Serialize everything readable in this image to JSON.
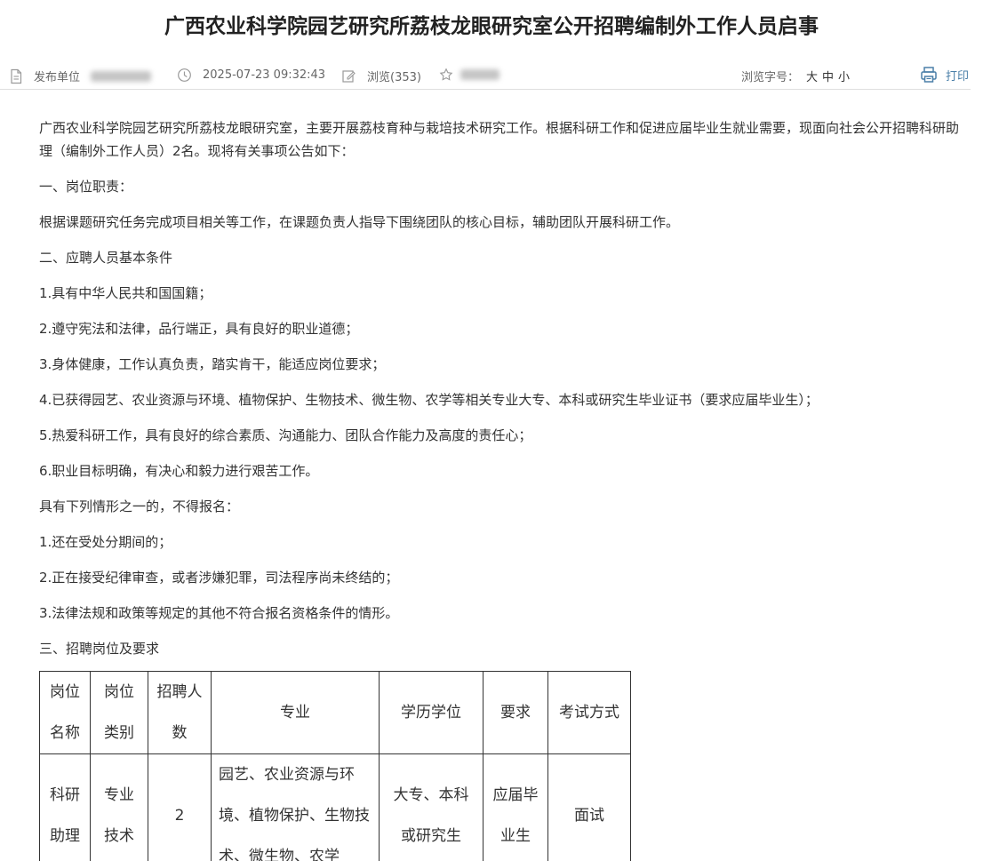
{
  "title": "广西农业科学院园艺研究所荔枝龙眼研究室公开招聘编制外工作人员启事",
  "meta": {
    "publisher_label": "发布单位",
    "datetime": "2025-07-23 09:32:43",
    "views": "浏览(353)",
    "font_size_label": "浏览字号：",
    "font_large": "大",
    "font_medium": "中",
    "font_small": "小",
    "print_label": "打印"
  },
  "body": {
    "intro": "广西农业科学院园艺研究所荔枝龙眼研究室，主要开展荔枝育种与栽培技术研究工作。根据科研工作和促进应届毕业生就业需要，现面向社会公开招聘科研助理（编制外工作人员）2名。现将有关事项公告如下：",
    "section1_title": "一、岗位职责：",
    "section1_text": "根据课题研究任务完成项目相关等工作，在课题负责人指导下围绕团队的核心目标，辅助团队开展科研工作。",
    "section2_title": "二、应聘人员基本条件",
    "conditions": [
      "1.具有中华人民共和国国籍；",
      "2.遵守宪法和法律，品行端正，具有良好的职业道德；",
      "3.身体健康，工作认真负责，踏实肯干，能适应岗位要求；",
      "4.已获得园艺、农业资源与环境、植物保护、生物技术、微生物、农学等相关专业大专、本科或研究生毕业证书（要求应届毕业生）；",
      "5.热爱科研工作，具有良好的综合素质、沟通能力、团队合作能力及高度的责任心；",
      "6.职业目标明确，有决心和毅力进行艰苦工作。"
    ],
    "exclusion_title": "具有下列情形之一的，不得报名：",
    "exclusions": [
      "1.还在受处分期间的；",
      "2.正在接受纪律审查，或者涉嫌犯罪，司法程序尚未终结的；",
      "3.法律法规和政策等规定的其他不符合报名资格条件的情形。"
    ],
    "section3_title": "三、招聘岗位及要求"
  },
  "table": {
    "headers": [
      "岗位名称",
      "岗位类别",
      "招聘人数",
      "专业",
      "学历学位",
      "要求",
      "考试方式"
    ],
    "row": [
      "科研助理",
      "专业技术",
      "2",
      "园艺、农业资源与环境、植物保护、生物技术、微生物、农学",
      "大专、本科或研究生",
      "应届毕业生",
      "面试"
    ]
  },
  "colors": {
    "text": "#333333",
    "print_icon": "#4a7fa8",
    "divider": "#dedede"
  }
}
